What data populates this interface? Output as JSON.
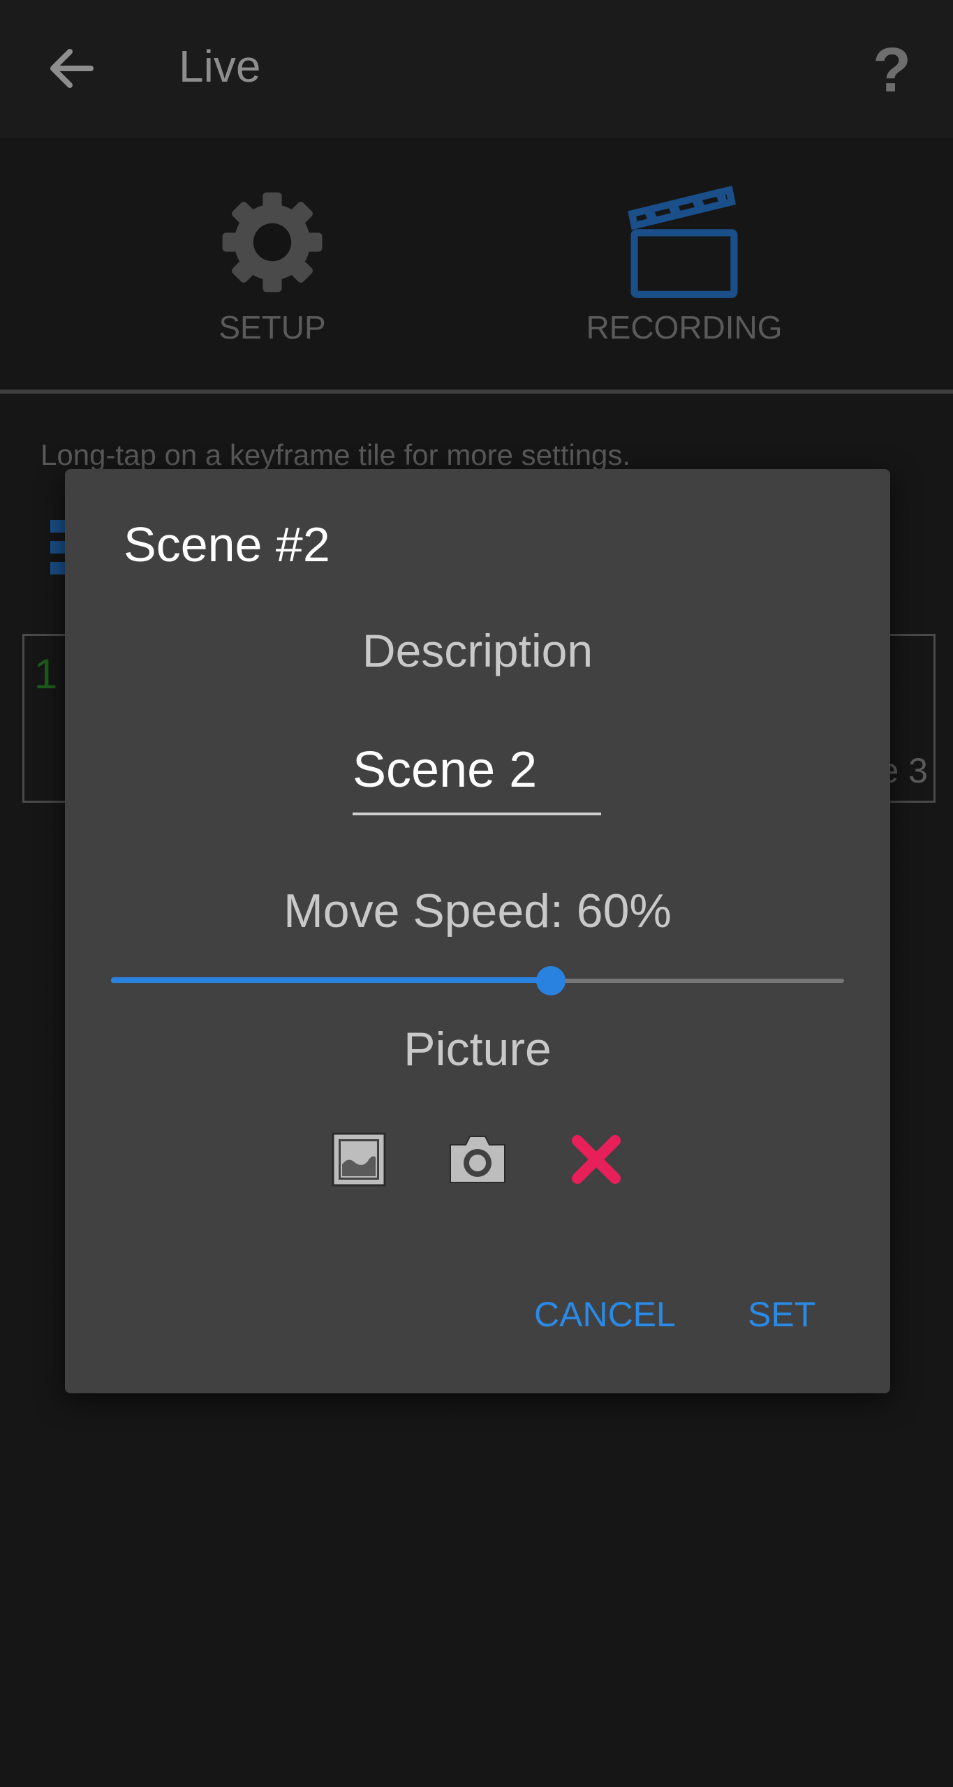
{
  "appbar": {
    "title": "Live",
    "help_label": "?"
  },
  "tabs": [
    {
      "label": "SETUP",
      "icon": "gear-icon"
    },
    {
      "label": "RECORDING",
      "icon": "clapperboard-icon"
    }
  ],
  "hint": "Long-tap on a keyframe tile for more settings.",
  "tiles": {
    "left_number": "1",
    "right_label": "e 3"
  },
  "dialog": {
    "title": "Scene #2",
    "description_label": "Description",
    "description_value": "Scene 2",
    "move_speed_label": "Move Speed: 60%",
    "move_speed_percent": 60,
    "picture_label": "Picture",
    "picture_icons": [
      "gallery-icon",
      "camera-icon",
      "delete-icon"
    ],
    "cancel_label": "CANCEL",
    "set_label": "SET"
  },
  "colors": {
    "accent": "#2a82e0",
    "delete": "#e8205a",
    "dialog_bg": "#414141",
    "appbar_bg": "#1b1b1b",
    "recording_icon": "#1a4f8a"
  }
}
